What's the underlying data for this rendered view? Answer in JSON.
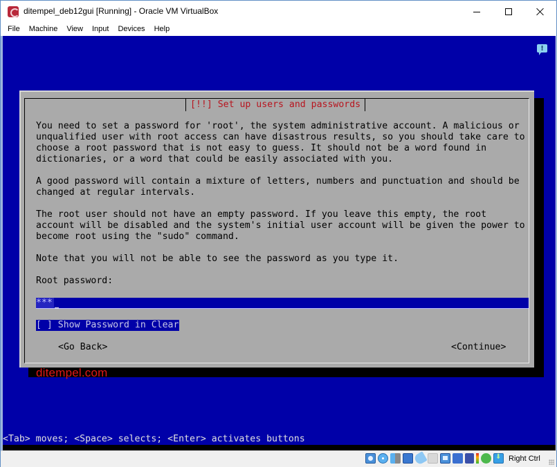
{
  "window": {
    "title": "ditempel_deb12gui [Running] - Oracle VM VirtualBox",
    "app_icon": "debian-swirl-icon",
    "controls": {
      "minimize": "minimize-icon",
      "maximize": "maximize-icon",
      "close": "close-icon"
    }
  },
  "menubar": {
    "items": [
      {
        "label": "File"
      },
      {
        "label": "Machine"
      },
      {
        "label": "View"
      },
      {
        "label": "Input"
      },
      {
        "label": "Devices"
      },
      {
        "label": "Help"
      }
    ]
  },
  "vm": {
    "notification_icon": "!",
    "dialog": {
      "title": "[!!] Set up users and passwords",
      "paragraphs": [
        "You need to set a password for 'root', the system administrative account. A malicious or\nunqualified user with root access can have disastrous results, so you should take care to\nchoose a root password that is not easy to guess. It should not be a word found in\ndictionaries, or a word that could be easily associated with you.",
        "A good password will contain a mixture of letters, numbers and punctuation and should be\nchanged at regular intervals.",
        "The root user should not have an empty password. If you leave this empty, the root\naccount will be disabled and the system's initial user account will be given the power to\nbecome root using the \"sudo\" command.",
        "Note that you will not be able to see the password as you type it."
      ],
      "field_label": "Root password:",
      "password_value": "***",
      "show_password_checkbox": {
        "label": "[ ] Show Password in Clear",
        "checked": false
      },
      "buttons": {
        "back": "<Go Back>",
        "continue": "<Continue>"
      }
    },
    "watermark": "ditempel.com",
    "help_line": "<Tab> moves; <Space> selects; <Enter> activates buttons",
    "colors": {
      "background": "#0000a8",
      "dialog": "#aaaaaa",
      "title_text": "#b8141e",
      "watermark": "#e01818"
    }
  },
  "statusbar": {
    "icons": [
      "hard-disk-icon",
      "optical-drive-icon",
      "audio-icon",
      "network-icon",
      "usb-icon",
      "shared-folders-icon",
      "display-icon",
      "video-capture-icon",
      "vt-x-icon",
      "cpu-meter-icon",
      "mouse-integration-icon",
      "keyboard-capture-icon"
    ],
    "host_key": "Right Ctrl"
  }
}
